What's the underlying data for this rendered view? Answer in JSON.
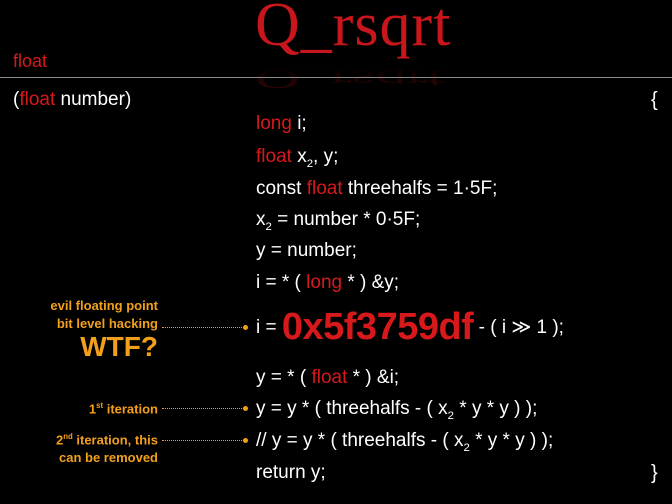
{
  "title": "Q_rsqrt",
  "return_type": "float",
  "signature": {
    "open_paren": "(",
    "param_type": "float",
    "param_name": " number)"
  },
  "braces": {
    "open": "{",
    "close": "}"
  },
  "code": {
    "line1": {
      "type": "long",
      "rest": " i;"
    },
    "line2": {
      "type": "float",
      "var": " x",
      "sub": "2",
      "rest": ", y;"
    },
    "line3": {
      "kw": "const ",
      "type": "float",
      "name": " threehalfs ",
      "op": "=",
      "val": " 1·5F;"
    },
    "line4": {
      "var": "x",
      "sub": "2",
      "op": " = ",
      "rest": "number * 0·5F;"
    },
    "line5": {
      "var": "y ",
      "op": "=",
      "rest": " number;"
    },
    "line6": {
      "pre": "i = * ( ",
      "type": "long",
      "post": " * ) &y;"
    },
    "line7": {
      "pre": "i = ",
      "magic": "0x5f3759df",
      "post": " - ( i ≫ 1 );"
    },
    "line8": {
      "pre": "y = * ( ",
      "type": "float",
      "post": " * ) &i;"
    },
    "line9": {
      "pre": "y = y * ( threehalfs - ( x",
      "sub": "2",
      "post": " * y * y ) );"
    },
    "line10": {
      "pre": "// y = y * ( threehalfs - ( x",
      "sub": "2",
      "post": " * y * y ) );"
    },
    "line11": {
      "kw": "return",
      "rest": " y;"
    }
  },
  "annotations": {
    "evil_line1": "evil floating point",
    "evil_line2": "bit level hacking",
    "wtf": "WTF?",
    "first_base": "1",
    "first_sup": "st",
    "first_rest": " iteration",
    "second_base": "2",
    "second_sup": "nd",
    "second_rest": " iteration, this",
    "second_line2": "can be removed"
  },
  "colors": {
    "background": "#000000",
    "keyword_red": "#d7191b",
    "annotation_orange": "#f2a01c",
    "comment_grey": "#9a9a9a"
  }
}
